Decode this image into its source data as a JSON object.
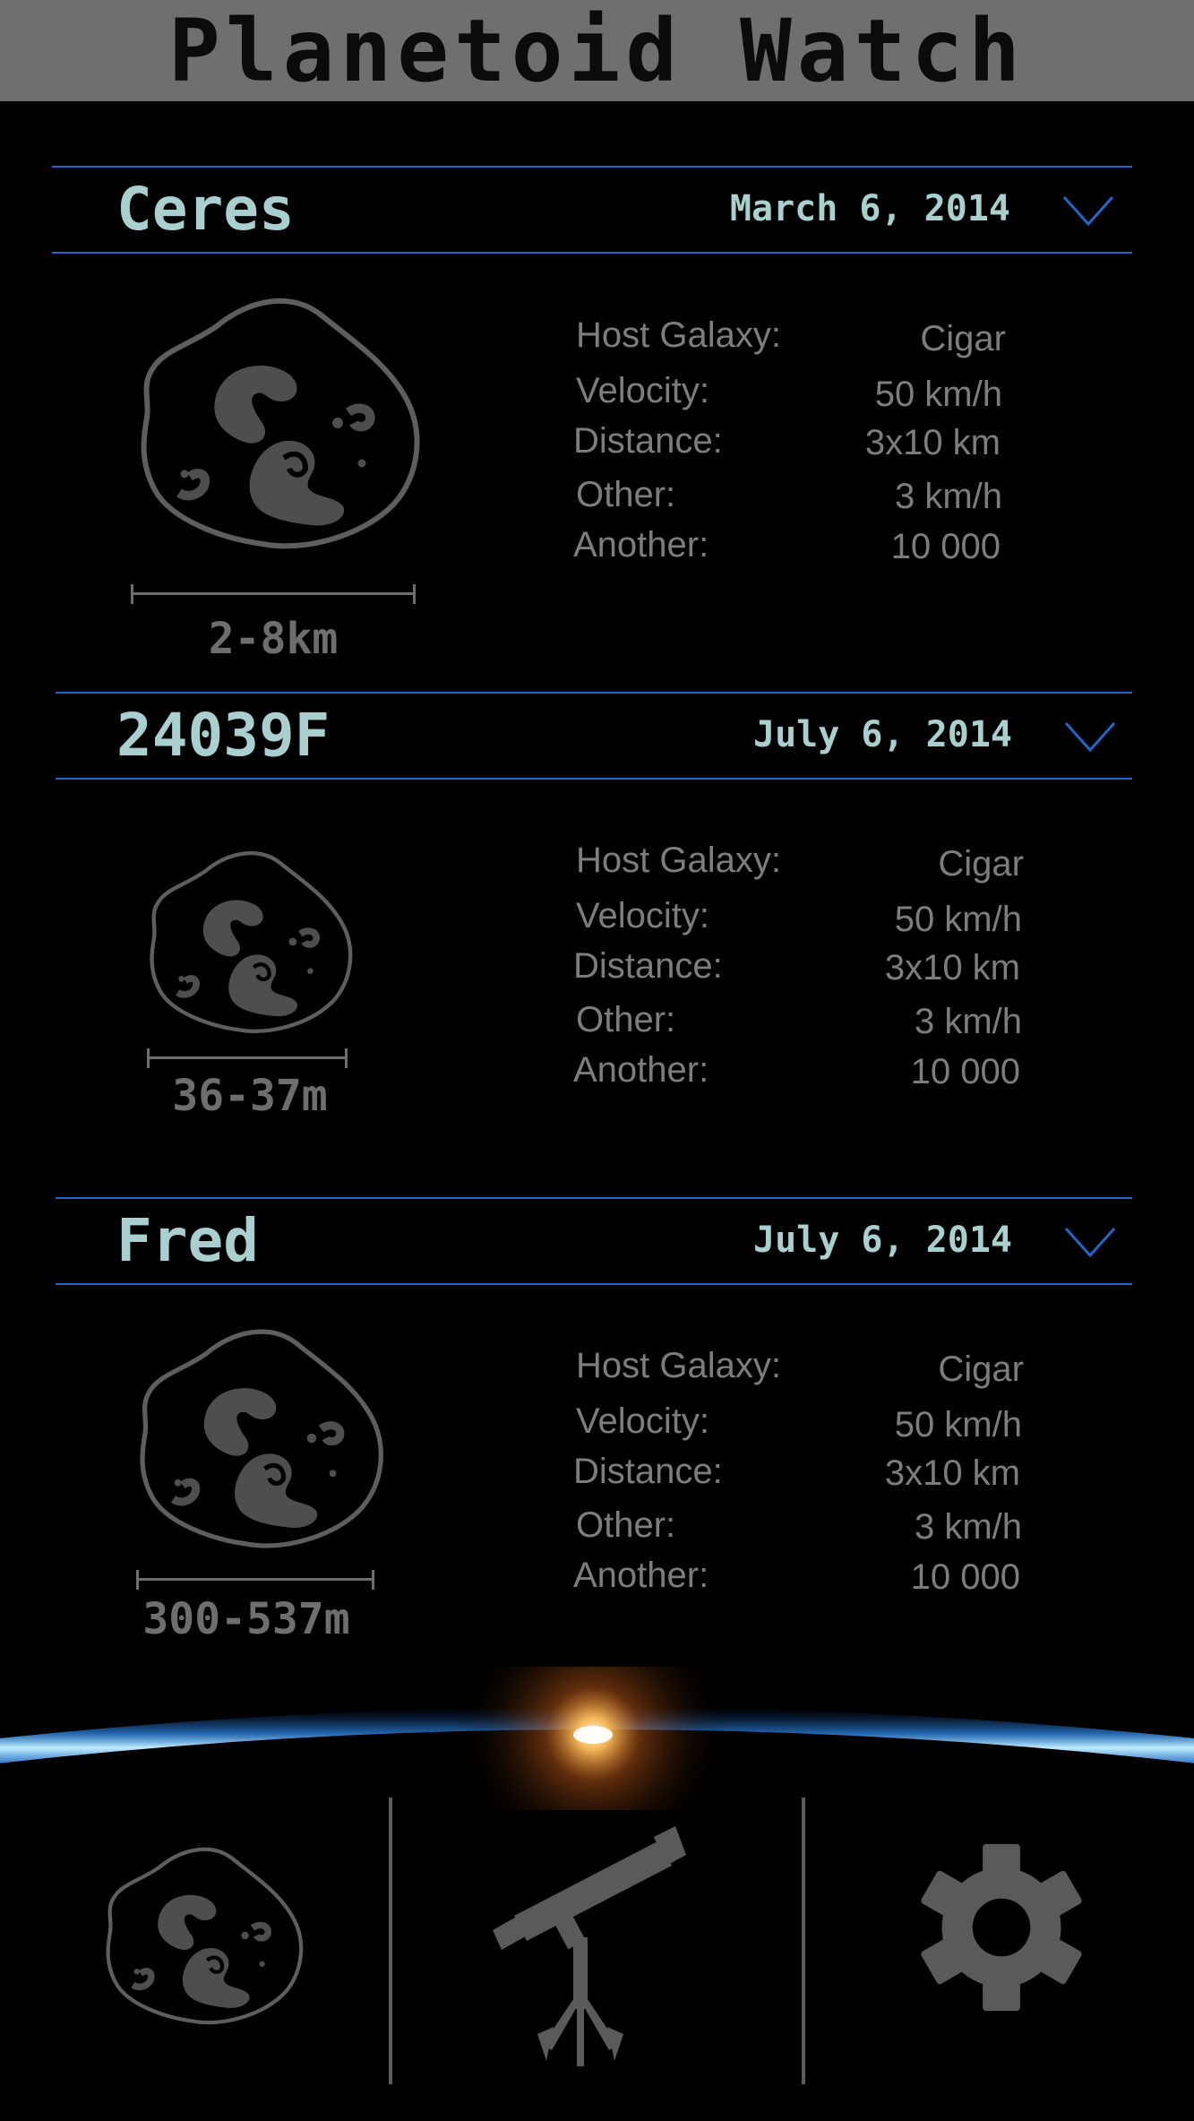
{
  "app": {
    "title": "Planetoid Watch"
  },
  "stat_labels": {
    "host_galaxy": "Host Galaxy:",
    "velocity": "Velocity:",
    "distance": "Distance:",
    "other": "Other:",
    "another": "Another:"
  },
  "planetoids": [
    {
      "name": "Ceres",
      "date": "March 6, 2014",
      "size": "2-8km",
      "host_galaxy": "Cigar",
      "velocity": "50 km/h",
      "distance": "3x10 km",
      "other": "3 km/h",
      "another": "10 000"
    },
    {
      "name": "24039F",
      "date": "July 6, 2014",
      "size": "36-37m",
      "host_galaxy": "Cigar",
      "velocity": "50 km/h",
      "distance": "3x10 km",
      "other": "3 km/h",
      "another": "10 000"
    },
    {
      "name": "Fred",
      "date": "July 6, 2014",
      "size": "300-537m",
      "host_galaxy": "Cigar",
      "velocity": "50 km/h",
      "distance": "3x10 km",
      "other": "3 km/h",
      "another": "10 000"
    }
  ],
  "tabs": [
    {
      "icon": "asteroid-icon"
    },
    {
      "icon": "telescope-icon"
    },
    {
      "icon": "gear-icon"
    }
  ],
  "colors": {
    "accent_line": "#1f67c8",
    "heading_text": "#a9d0cf",
    "muted_text": "#7d7d7d",
    "title_bar": "#6f6f6f"
  }
}
